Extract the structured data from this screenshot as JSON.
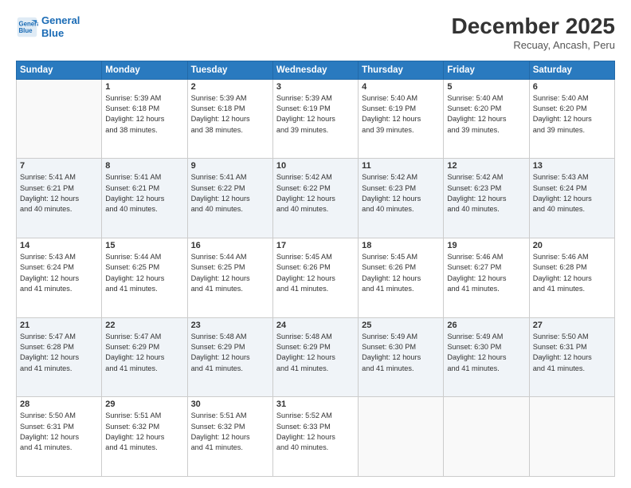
{
  "header": {
    "logo_line1": "General",
    "logo_line2": "Blue",
    "month": "December 2025",
    "location": "Recuay, Ancash, Peru"
  },
  "days_of_week": [
    "Sunday",
    "Monday",
    "Tuesday",
    "Wednesday",
    "Thursday",
    "Friday",
    "Saturday"
  ],
  "weeks": [
    [
      {
        "day": "",
        "info": ""
      },
      {
        "day": "1",
        "info": "Sunrise: 5:39 AM\nSunset: 6:18 PM\nDaylight: 12 hours\nand 38 minutes."
      },
      {
        "day": "2",
        "info": "Sunrise: 5:39 AM\nSunset: 6:18 PM\nDaylight: 12 hours\nand 38 minutes."
      },
      {
        "day": "3",
        "info": "Sunrise: 5:39 AM\nSunset: 6:19 PM\nDaylight: 12 hours\nand 39 minutes."
      },
      {
        "day": "4",
        "info": "Sunrise: 5:40 AM\nSunset: 6:19 PM\nDaylight: 12 hours\nand 39 minutes."
      },
      {
        "day": "5",
        "info": "Sunrise: 5:40 AM\nSunset: 6:20 PM\nDaylight: 12 hours\nand 39 minutes."
      },
      {
        "day": "6",
        "info": "Sunrise: 5:40 AM\nSunset: 6:20 PM\nDaylight: 12 hours\nand 39 minutes."
      }
    ],
    [
      {
        "day": "7",
        "info": "Sunrise: 5:41 AM\nSunset: 6:21 PM\nDaylight: 12 hours\nand 40 minutes."
      },
      {
        "day": "8",
        "info": "Sunrise: 5:41 AM\nSunset: 6:21 PM\nDaylight: 12 hours\nand 40 minutes."
      },
      {
        "day": "9",
        "info": "Sunrise: 5:41 AM\nSunset: 6:22 PM\nDaylight: 12 hours\nand 40 minutes."
      },
      {
        "day": "10",
        "info": "Sunrise: 5:42 AM\nSunset: 6:22 PM\nDaylight: 12 hours\nand 40 minutes."
      },
      {
        "day": "11",
        "info": "Sunrise: 5:42 AM\nSunset: 6:23 PM\nDaylight: 12 hours\nand 40 minutes."
      },
      {
        "day": "12",
        "info": "Sunrise: 5:42 AM\nSunset: 6:23 PM\nDaylight: 12 hours\nand 40 minutes."
      },
      {
        "day": "13",
        "info": "Sunrise: 5:43 AM\nSunset: 6:24 PM\nDaylight: 12 hours\nand 40 minutes."
      }
    ],
    [
      {
        "day": "14",
        "info": "Sunrise: 5:43 AM\nSunset: 6:24 PM\nDaylight: 12 hours\nand 41 minutes."
      },
      {
        "day": "15",
        "info": "Sunrise: 5:44 AM\nSunset: 6:25 PM\nDaylight: 12 hours\nand 41 minutes."
      },
      {
        "day": "16",
        "info": "Sunrise: 5:44 AM\nSunset: 6:25 PM\nDaylight: 12 hours\nand 41 minutes."
      },
      {
        "day": "17",
        "info": "Sunrise: 5:45 AM\nSunset: 6:26 PM\nDaylight: 12 hours\nand 41 minutes."
      },
      {
        "day": "18",
        "info": "Sunrise: 5:45 AM\nSunset: 6:26 PM\nDaylight: 12 hours\nand 41 minutes."
      },
      {
        "day": "19",
        "info": "Sunrise: 5:46 AM\nSunset: 6:27 PM\nDaylight: 12 hours\nand 41 minutes."
      },
      {
        "day": "20",
        "info": "Sunrise: 5:46 AM\nSunset: 6:28 PM\nDaylight: 12 hours\nand 41 minutes."
      }
    ],
    [
      {
        "day": "21",
        "info": "Sunrise: 5:47 AM\nSunset: 6:28 PM\nDaylight: 12 hours\nand 41 minutes."
      },
      {
        "day": "22",
        "info": "Sunrise: 5:47 AM\nSunset: 6:29 PM\nDaylight: 12 hours\nand 41 minutes."
      },
      {
        "day": "23",
        "info": "Sunrise: 5:48 AM\nSunset: 6:29 PM\nDaylight: 12 hours\nand 41 minutes."
      },
      {
        "day": "24",
        "info": "Sunrise: 5:48 AM\nSunset: 6:29 PM\nDaylight: 12 hours\nand 41 minutes."
      },
      {
        "day": "25",
        "info": "Sunrise: 5:49 AM\nSunset: 6:30 PM\nDaylight: 12 hours\nand 41 minutes."
      },
      {
        "day": "26",
        "info": "Sunrise: 5:49 AM\nSunset: 6:30 PM\nDaylight: 12 hours\nand 41 minutes."
      },
      {
        "day": "27",
        "info": "Sunrise: 5:50 AM\nSunset: 6:31 PM\nDaylight: 12 hours\nand 41 minutes."
      }
    ],
    [
      {
        "day": "28",
        "info": "Sunrise: 5:50 AM\nSunset: 6:31 PM\nDaylight: 12 hours\nand 41 minutes."
      },
      {
        "day": "29",
        "info": "Sunrise: 5:51 AM\nSunset: 6:32 PM\nDaylight: 12 hours\nand 41 minutes."
      },
      {
        "day": "30",
        "info": "Sunrise: 5:51 AM\nSunset: 6:32 PM\nDaylight: 12 hours\nand 41 minutes."
      },
      {
        "day": "31",
        "info": "Sunrise: 5:52 AM\nSunset: 6:33 PM\nDaylight: 12 hours\nand 40 minutes."
      },
      {
        "day": "",
        "info": ""
      },
      {
        "day": "",
        "info": ""
      },
      {
        "day": "",
        "info": ""
      }
    ]
  ]
}
